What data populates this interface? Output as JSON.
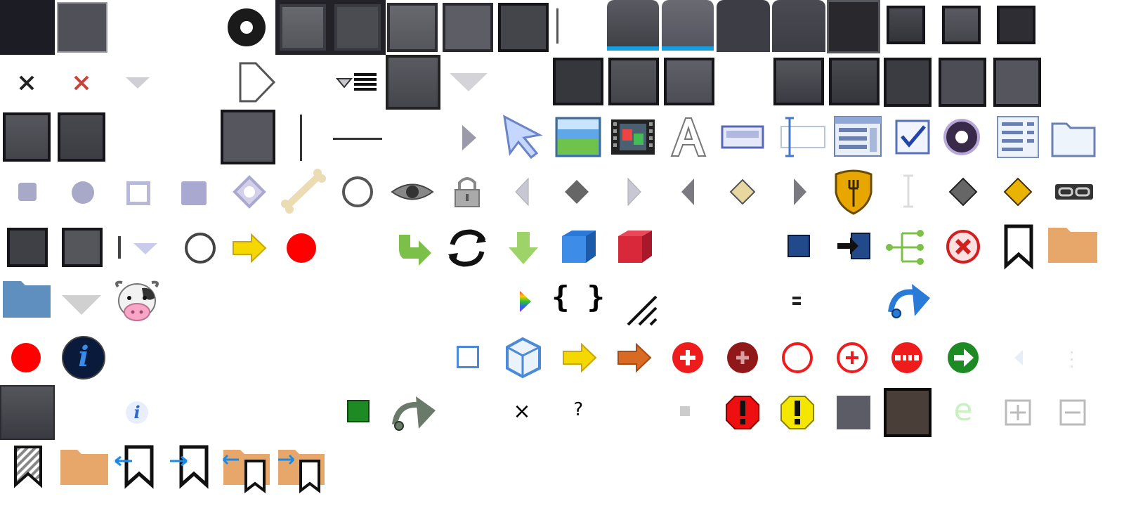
{
  "sheet": {
    "colors": {
      "dark_frame": "#1b1b20",
      "button_face": "#55555c",
      "tab_highlight": "#14a0e0",
      "red": "#ff0000",
      "yellow": "#f5d800",
      "orange_folder": "#e8a76a",
      "blue_folder": "#5f8fbf",
      "green": "#7cc04a"
    },
    "glyphs": {
      "close_x": "×",
      "question": "?",
      "braces": "{ }",
      "letter_e": "e",
      "info_i": "i"
    },
    "icons": [
      "window-frame-icon",
      "button-icon",
      "radio-dark-icon",
      "button-pair-icon",
      "tab-active-icon",
      "tab-inactive-icon",
      "close-icon",
      "close-red-icon",
      "dropdown-arrow-icon",
      "play-outline-icon",
      "list-dropdown-icon",
      "pointer-icon",
      "image-icon",
      "film-icon",
      "font-icon",
      "textbox-icon",
      "text-cursor-icon",
      "table-icon",
      "checkbox-icon",
      "radio-icon",
      "form-icon",
      "folder-outline-icon",
      "bone-icon",
      "eye-icon",
      "lock-icon",
      "arrow-left-icon",
      "diamond-icon",
      "arrow-right-icon",
      "shield-fork-icon",
      "link-icon",
      "arrow-yellow-icon",
      "record-icon",
      "green-redo-icon",
      "refresh-icon",
      "down-arrow-icon",
      "blue-cube-icon",
      "red-cube-icon",
      "blue-square-icon",
      "enter-icon",
      "tree-icon",
      "error-icon",
      "bookmark-icon",
      "folder-orange-icon",
      "folder-blue-icon",
      "cow-icon",
      "rainbow-play-icon",
      "braces-icon",
      "resize-grip-icon",
      "redo-blue-icon",
      "info-icon",
      "add-circle-icon",
      "remove-circle-icon",
      "green-arrow-circle-icon",
      "warning-icon",
      "plus-box-icon",
      "minus-box-icon",
      "bookmark-import-icon",
      "bookmark-export-icon"
    ]
  }
}
